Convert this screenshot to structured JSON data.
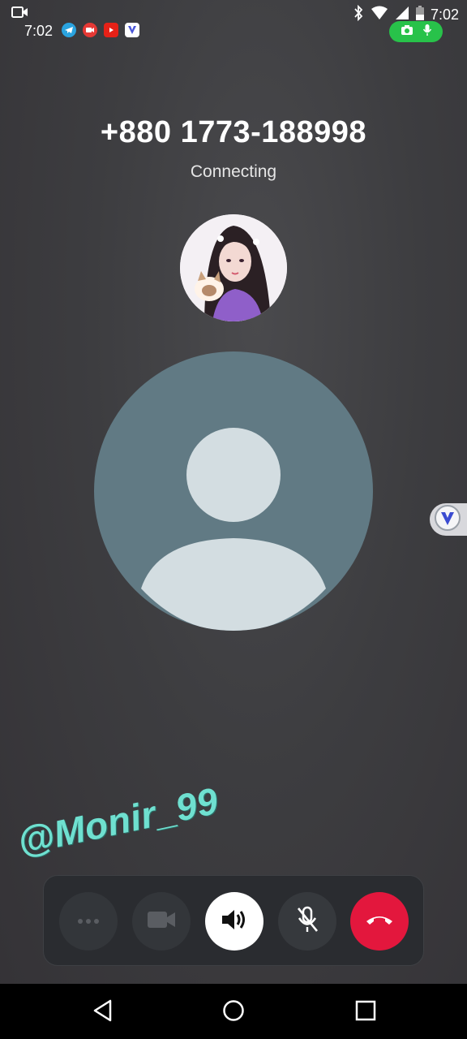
{
  "status_bar": {
    "time_left": "7:02",
    "time_right": "7:02",
    "apps": [
      {
        "name": "telegram-icon",
        "color": "#2aa3df"
      },
      {
        "name": "screen-recorder-icon",
        "color": "#e53935"
      },
      {
        "name": "youtube-icon",
        "color": "#e62117"
      },
      {
        "name": "vpn-app-icon",
        "color": "#4a56d8"
      }
    ],
    "recording_pill_color": "#28c24a"
  },
  "call": {
    "number": "+880 1773-188998",
    "status": "Connecting"
  },
  "watermark": "@Monir_99",
  "controls": {
    "accent_end": "#e3173d",
    "buttons": [
      {
        "name": "more-options",
        "active": false
      },
      {
        "name": "video",
        "active": false
      },
      {
        "name": "speaker",
        "active": true
      },
      {
        "name": "mute",
        "active": false
      },
      {
        "name": "end-call",
        "active": true
      }
    ]
  }
}
